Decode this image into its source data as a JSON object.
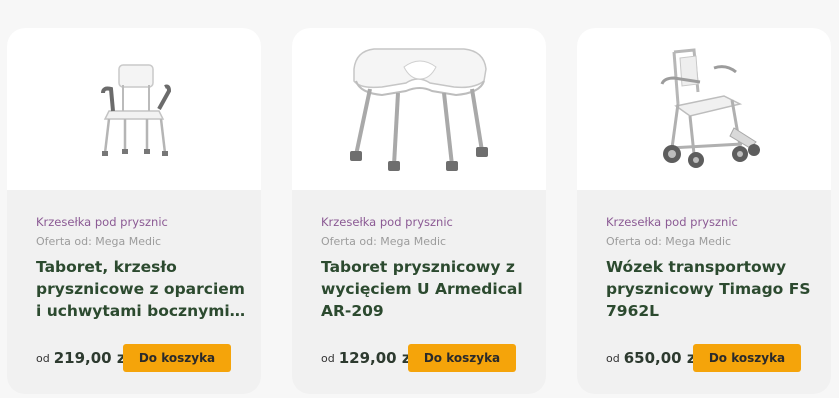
{
  "products": [
    {
      "category": "Krzesełka pod prysznic",
      "seller": "Oferta od: Mega Medic",
      "title": "Taboret, krzesło prysznicowe z oparciem i uchwytami bocznymi…",
      "price_prefix": "od",
      "price": "219,00 zł",
      "button_label": "Do koszyka",
      "image_icon": "shower-chair-with-armrests-icon"
    },
    {
      "category": "Krzesełka pod prysznic",
      "seller": "Oferta od: Mega Medic",
      "title": "Taboret prysznicowy z wycięciem U Armedical AR-209",
      "price_prefix": "od",
      "price": "129,00 zł",
      "button_label": "Do koszyka",
      "image_icon": "u-cutout-shower-stool-icon"
    },
    {
      "category": "Krzesełka pod prysznic",
      "seller": "Oferta od: Mega Medic",
      "title": "Wózek transportowy prysznicowy Timago FS 7962L",
      "price_prefix": "od",
      "price": "650,00 zł",
      "button_label": "Do koszyka",
      "image_icon": "shower-transport-wheelchair-icon"
    }
  ],
  "colors": {
    "accent_button": "#f5a40a",
    "category_text": "#8b5a94",
    "title_text": "#2c4a2f"
  }
}
